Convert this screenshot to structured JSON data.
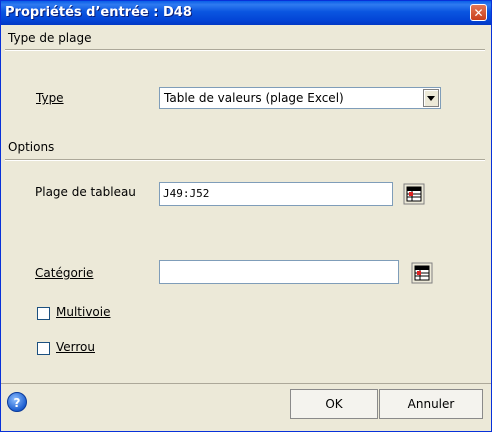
{
  "window": {
    "title": "Propriétés d’entrée : D48",
    "close_glyph": "✕"
  },
  "section_range_type": {
    "title": "Type de plage",
    "type_label": "Type",
    "type_value": "Table de valeurs (plage Excel)"
  },
  "section_options": {
    "title": "Options",
    "table_range_label": "Plage de tableau",
    "table_range_value": "J49:J52",
    "category_label": "Catégorie",
    "category_value": "",
    "multiway_label": "Multivoie",
    "multiway_checked": false,
    "lock_label": "Verrou",
    "lock_checked": false
  },
  "footer": {
    "help_glyph": "?",
    "ok_label": "OK",
    "cancel_label": "Annuler"
  },
  "icons": [
    "close-icon",
    "dropdown-arrow-icon",
    "range-select-icon",
    "help-icon"
  ],
  "colors": {
    "titlebar": "#0a55e0",
    "dialog_bg": "#ece9d8",
    "field_border": "#7f9db9"
  }
}
